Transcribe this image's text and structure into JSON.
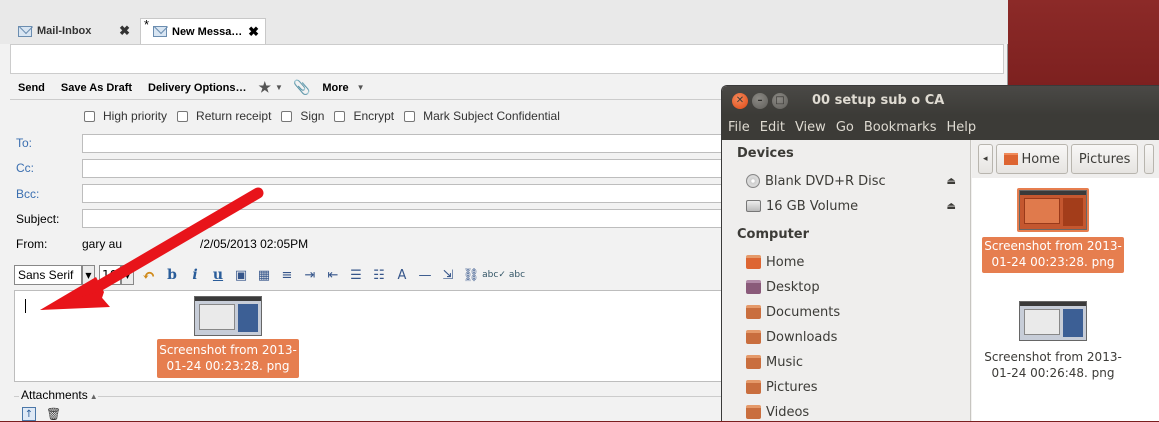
{
  "mail": {
    "tabs": [
      {
        "label": "Mail-Inbox",
        "close": "✖"
      },
      {
        "label": "New Messa…",
        "modified": "*",
        "close": "✖"
      }
    ],
    "toolbar": {
      "send": "Send",
      "save_draft": "Save As Draft",
      "delivery_options": "Delivery Options…",
      "more": "More"
    },
    "options": {
      "high_priority": "High priority",
      "return_receipt": "Return receipt",
      "sign": "Sign",
      "encrypt": "Encrypt",
      "mark_confidential": "Mark Subject Confidential"
    },
    "fields": {
      "to": "To:",
      "cc": "Cc:",
      "bcc": "Bcc:",
      "subject": "Subject:",
      "from": "From:",
      "from_name": "gary au",
      "from_date": "/2/05/2013 02:05PM"
    },
    "format": {
      "font": "Sans Serif",
      "size": "10"
    },
    "editor": {
      "dragged_file_label": "Screenshot from 2013-01-24 00:23:28. png"
    },
    "attachments": {
      "label": "Attachments"
    }
  },
  "file_manager": {
    "title": "00 setup sub o CA",
    "menu": [
      "File",
      "Edit",
      "View",
      "Go",
      "Bookmarks",
      "Help"
    ],
    "sidebar": {
      "devices_heading": "Devices",
      "devices": [
        "Blank DVD+R Disc",
        "16 GB Volume"
      ],
      "computer_heading": "Computer",
      "places": [
        "Home",
        "Desktop",
        "Documents",
        "Downloads",
        "Music",
        "Pictures",
        "Videos"
      ]
    },
    "pathbar": [
      "Home",
      "Pictures"
    ],
    "files": [
      {
        "name": "Screenshot from 2013-01-24 00:23:28. png",
        "selected": true
      },
      {
        "name": "Screenshot from 2013-01-24 00:26:48. png",
        "selected": false
      }
    ]
  },
  "colors": {
    "selection": "#e67e4f",
    "desktop": "#7a1e1e",
    "arrow": "#e8141a"
  }
}
